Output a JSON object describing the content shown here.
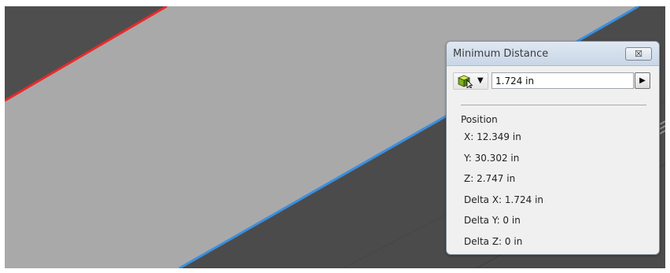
{
  "viewport": {
    "background_color": "#505050",
    "surface_color": "#a9a9a9",
    "red_edge_color": "#e82a2a",
    "blue_edge_color": "#3a8fe0"
  },
  "dialog": {
    "title": "Minimum Distance",
    "close_label": "☒",
    "selection_icon": "part-select-cube-icon",
    "dropdown_glyph": "▼",
    "distance_value": "1.724 in",
    "expand_glyph": "▶",
    "section_label": "Position",
    "coordinates": [
      "X: 12.349 in",
      "Y: 30.302 in",
      "Z: 2.747 in",
      "Delta X: 1.724 in",
      "Delta Y: 0 in",
      "Delta Z: 0 in"
    ]
  }
}
